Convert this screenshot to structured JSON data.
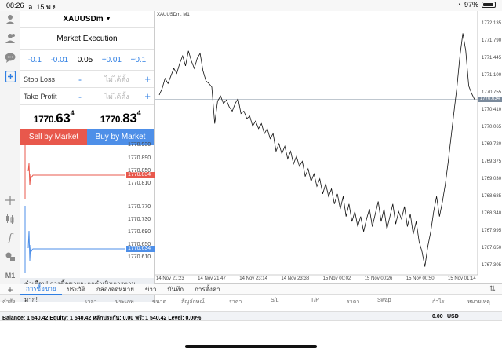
{
  "status": {
    "time": "08:26",
    "date": "อ. 15 พ.ย.",
    "battery": "97%"
  },
  "rail": {
    "m1_label": "M1"
  },
  "order": {
    "symbol": "XAUUSDm",
    "execution": "Market Execution",
    "volume_steps": [
      "-0.1",
      "-0.01",
      "0.05",
      "+0.01",
      "+0.1"
    ],
    "stop_loss": {
      "label": "Stop Loss",
      "value": "ไม่ได้ตั้ง",
      "minus": "-",
      "plus": "+"
    },
    "take_profit": {
      "label": "Take Profit",
      "value": "ไม่ได้ตั้ง",
      "minus": "-",
      "plus": "+"
    },
    "bid": {
      "lead": "1770.",
      "big": "63",
      "pip": "4"
    },
    "ask": {
      "lead": "1770.",
      "big": "83",
      "pip": "4"
    },
    "sell_label": "Sell by Market",
    "buy_label": "Buy by Market",
    "bid_chart": {
      "labels": [
        "1770.930",
        "1770.890",
        "1770.850",
        "1770.810"
      ],
      "current": "1770.834",
      "color": "#e8584c"
    },
    "ask_chart": {
      "labels": [
        "1770.770",
        "1770.730",
        "1770.690",
        "1770.650",
        "1770.610"
      ],
      "current": "1770.634",
      "color": "#4e8fe8"
    },
    "warning": "คำเตือน! การซื้อขายจะถูกดำเนินการตามสภาพตลาด ความแตกต่างกับราคาที่ส่งอาจมีมาก!"
  },
  "chart": {
    "title": "XAUUSDm, M1",
    "y_labels": [
      "1772.135",
      "1771.790",
      "1771.445",
      "1771.100",
      "1770.755",
      "1770.410",
      "1770.065",
      "1769.720",
      "1769.375",
      "1769.030",
      "1768.685",
      "1768.340",
      "1767.995",
      "1767.650",
      "1767.305"
    ],
    "current_price": "1770.634",
    "x_labels": [
      "14 Nov 21:23",
      "14 Nov 21:47",
      "14 Nov 23:14",
      "14 Nov 23:38",
      "15 Nov 00:02",
      "15 Nov 00:26",
      "15 Nov 00:50",
      "15 Nov 01:14"
    ]
  },
  "chart_data": {
    "type": "line",
    "title": "XAUUSDm, M1",
    "xlabel": "",
    "ylabel": "",
    "ylim": [
      1767.2,
      1772.3
    ],
    "x_ticks": [
      "14 Nov 21:23",
      "14 Nov 21:47",
      "14 Nov 23:14",
      "14 Nov 23:38",
      "15 Nov 00:02",
      "15 Nov 00:26",
      "15 Nov 00:50",
      "15 Nov 01:14"
    ],
    "series": [
      {
        "values": [
          1770.72,
          1770.85,
          1771.05,
          1770.95,
          1771.1,
          1771.25,
          1771.15,
          1771.35,
          1771.5,
          1771.3,
          1771.6,
          1771.4,
          1771.25,
          1771.45,
          1771.55,
          1771.2,
          1771.0,
          1770.95,
          1770.88,
          1770.15,
          1770.6,
          1770.7,
          1770.55,
          1770.62,
          1770.48,
          1770.4,
          1770.55,
          1770.65,
          1770.35,
          1770.4,
          1770.25,
          1770.3,
          1770.1,
          1770.2,
          1770.05,
          1770.15,
          1769.95,
          1770.05,
          1769.85,
          1769.95,
          1769.6,
          1769.75,
          1769.55,
          1769.7,
          1769.45,
          1769.6,
          1769.35,
          1769.5,
          1769.3,
          1769.4,
          1769.1,
          1769.25,
          1769.0,
          1769.15,
          1768.9,
          1769.05,
          1768.75,
          1768.95,
          1768.7,
          1768.85,
          1768.55,
          1768.75,
          1768.45,
          1768.7,
          1768.3,
          1768.55,
          1768.2,
          1768.4,
          1768.1,
          1768.3,
          1768.0,
          1768.25,
          1768.45,
          1768.1,
          1768.35,
          1768.6,
          1768.2,
          1768.45,
          1768.05,
          1768.3,
          1768.55,
          1768.15,
          1768.4,
          1768.25,
          1768.5,
          1768.1,
          1768.35,
          1767.95,
          1768.2,
          1767.8,
          1767.6,
          1767.3,
          1767.7,
          1768.0,
          1768.4,
          1768.7,
          1768.3,
          1768.6,
          1768.95,
          1769.4,
          1769.9,
          1770.4,
          1770.9,
          1771.5,
          1771.95,
          1771.6,
          1770.9,
          1770.75,
          1770.63
        ]
      }
    ],
    "current_price": 1770.634,
    "grid": false
  },
  "toolbox": {
    "tabs": [
      "การซื้อขาย",
      "ประวัติ",
      "กล่องจดหมาย",
      "ข่าว",
      "บันทึก",
      "การตั้งค่า"
    ],
    "columns": [
      "คำสั่ง",
      "เวลา",
      "ประเภท",
      "ขนาด",
      "สัญลักษณ์",
      "ราคา",
      "S/L",
      "T/P",
      "ราคา",
      "Swap",
      "กำไร",
      "หมายเหตุ"
    ],
    "balance": "Balance: 1 540.42 Equity: 1 540.42 หลักประกัน: 0.00 ฟรี: 1 540.42 Level: 0.00%",
    "profit_total": "0.00",
    "currency": "USD"
  }
}
